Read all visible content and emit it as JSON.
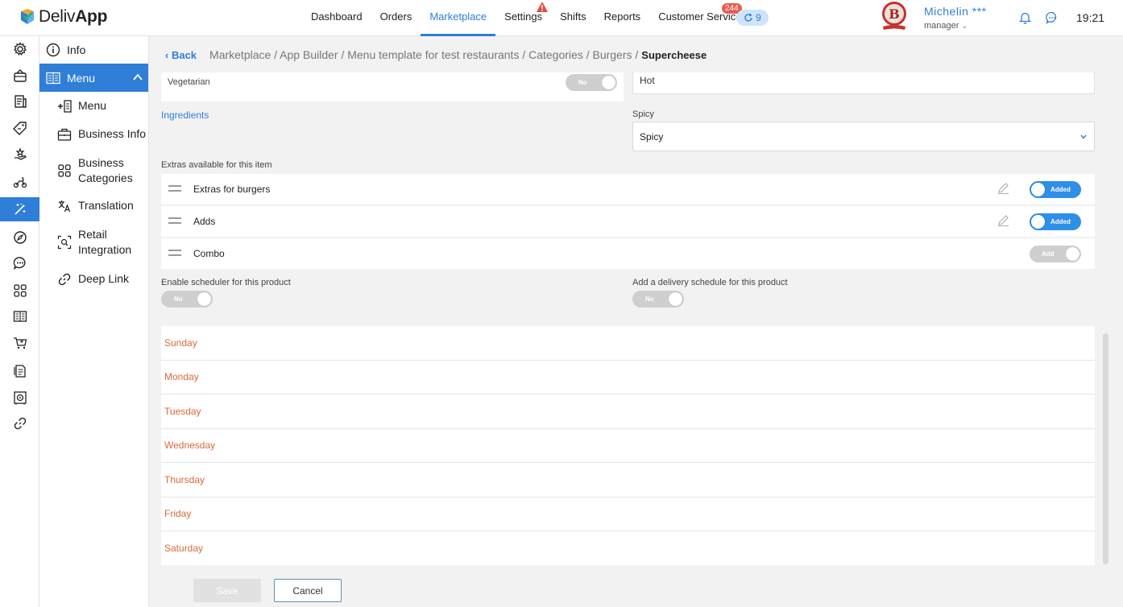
{
  "brand": {
    "logo_light": "Deliv",
    "logo_bold": "App"
  },
  "nav": [
    {
      "label": "Dashboard"
    },
    {
      "label": "Orders"
    },
    {
      "label": "Marketplace",
      "active": true
    },
    {
      "label": "Settings"
    },
    {
      "label": "Shifts"
    },
    {
      "label": "Reports"
    },
    {
      "label": "Customer Service"
    }
  ],
  "notifications": {
    "customer_service_badge": "244",
    "pill_count": "9"
  },
  "user": {
    "name": "Michelin ***",
    "role": "manager",
    "avatar_text": "B"
  },
  "clock": "19:21",
  "rail_icons": [
    "gear-icon",
    "basket-icon",
    "receipt-icon",
    "tag-icon",
    "hand-icon",
    "scooter-icon",
    "magic-wand-icon",
    "compass-icon",
    "chat-icon",
    "grid-icon",
    "book-icon",
    "cart-icon",
    "document-icon",
    "safe-icon",
    "link-icon"
  ],
  "subnav": {
    "info": "Info",
    "menu_head": "Menu",
    "items": [
      {
        "label": "Menu",
        "icon": "add-list-icon"
      },
      {
        "label": "Business Info",
        "icon": "briefcase-icon"
      },
      {
        "label": "Business Categories",
        "icon": "grid-icon"
      },
      {
        "label": "Translation",
        "icon": "translate-icon"
      },
      {
        "label": "Retail Integration",
        "icon": "scan-icon"
      },
      {
        "label": "Deep Link",
        "icon": "link-icon"
      }
    ]
  },
  "breadcrumb": {
    "back": "Back",
    "path": "Marketplace / App Builder / Menu template for test restaurants / Categories / Burgers /",
    "current": "Supercheese"
  },
  "form": {
    "vegetarian_label": "Vegetarian",
    "vegetarian_toggle": "No",
    "hot_value": "Hot",
    "ingredients_link": "Ingredients",
    "spicy_label": "Spicy",
    "spicy_value": "Spicy",
    "extras_label": "Extras available for this item",
    "extras": [
      {
        "name": "Extras for burgers",
        "toggle": "Added"
      },
      {
        "name": "Adds",
        "toggle": "Added"
      },
      {
        "name": "Combo",
        "toggle": "Add"
      }
    ],
    "scheduler_label": "Enable scheduler for this product",
    "scheduler_toggle": "No",
    "delivery_label": "Add a delivery schedule for this product",
    "delivery_toggle": "No",
    "days": [
      "Sunday",
      "Monday",
      "Tuesday",
      "Wednesday",
      "Thursday",
      "Friday",
      "Saturday"
    ]
  },
  "actions": {
    "save": "Save",
    "cancel": "Cancel"
  },
  "colors": {
    "accent": "#2f7ed8",
    "day_text": "#d9683a",
    "badge": "#e95c50"
  }
}
